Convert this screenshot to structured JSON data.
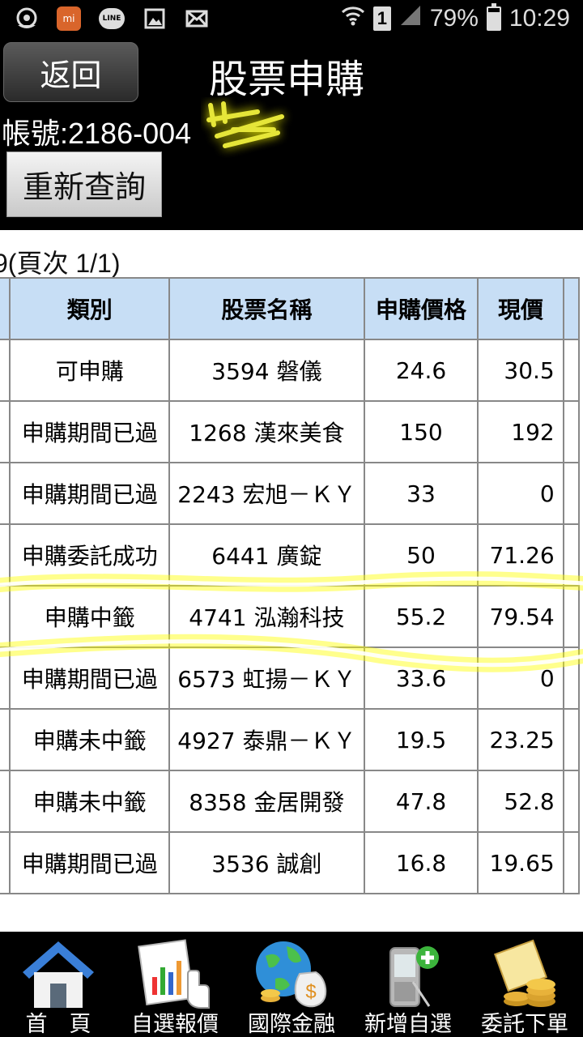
{
  "status_bar": {
    "battery": "79%",
    "time": "10:29",
    "sim": "1",
    "line_label": "LINE",
    "mi_label": "mi",
    "battery_level": 0.79
  },
  "header": {
    "back_label": "返回",
    "title": "股票申購",
    "account": "帳號:2186-004",
    "refresh_label": "重新查詢"
  },
  "page_info": "9(頁次 1/1)",
  "table": {
    "headers": [
      "類別",
      "股票名稱",
      "申購價格",
      "現價"
    ],
    "rows": [
      [
        "可申購",
        "3594 磐儀",
        "24.6",
        "30.5"
      ],
      [
        "申購期間已過",
        "1268 漢來美食",
        "150",
        "192"
      ],
      [
        "申購期間已過",
        "2243 宏旭－ＫＹ",
        "33",
        "0"
      ],
      [
        "申購委託成功",
        "6441 廣錠",
        "50",
        "71.26"
      ],
      [
        "申購中籤",
        "4741 泓瀚科技",
        "55.2",
        "79.54"
      ],
      [
        "申購期間已過",
        "6573 虹揚－ＫＹ",
        "33.6",
        "0"
      ],
      [
        "申購未中籤",
        "4927 泰鼎－ＫＹ",
        "19.5",
        "23.25"
      ],
      [
        "申購未中籤",
        "8358 金居開發",
        "47.8",
        "52.8"
      ],
      [
        "申購期間已過",
        "3536 誠創",
        "16.8",
        "19.65"
      ]
    ]
  },
  "nav": {
    "items": [
      {
        "label": "首　頁",
        "icon": "home-icon"
      },
      {
        "label": "自選報價",
        "icon": "quote-chart-icon"
      },
      {
        "label": "國際金融",
        "icon": "globe-money-icon"
      },
      {
        "label": "新增自選",
        "icon": "add-phone-icon"
      },
      {
        "label": "委託下單",
        "icon": "coins-icon"
      }
    ]
  },
  "colors": {
    "header_bg": "#000000",
    "table_header_bg": "#c7def5",
    "stock_link": "#2a2ab8",
    "highlight": "#ffff00"
  }
}
